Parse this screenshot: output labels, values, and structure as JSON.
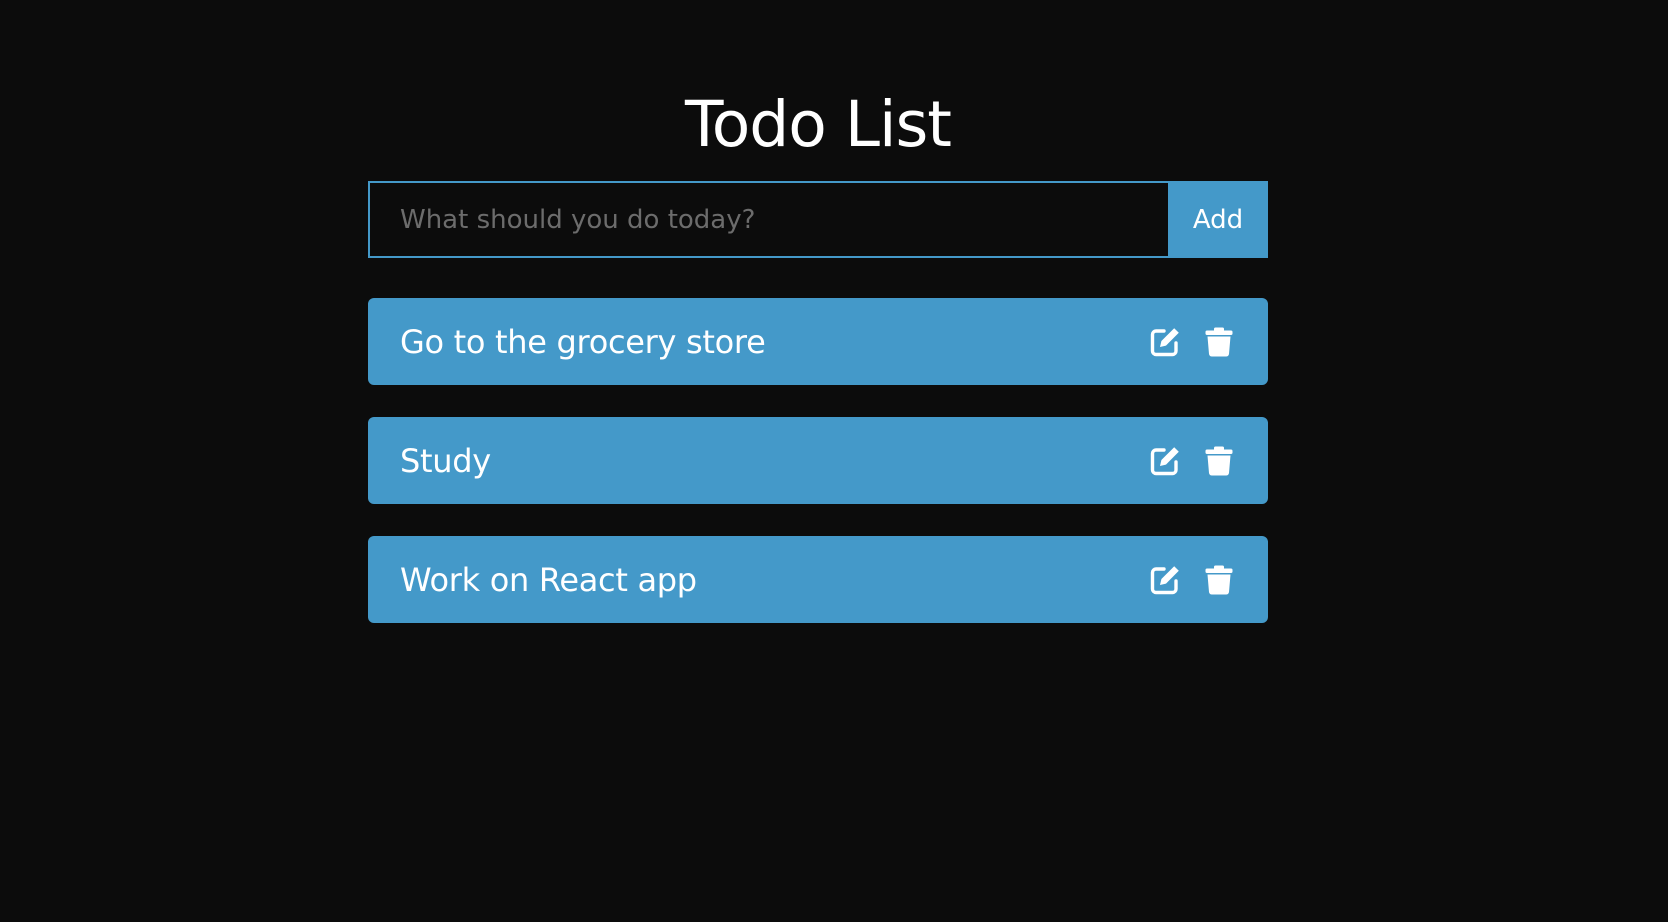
{
  "header": {
    "title": "Todo List"
  },
  "form": {
    "placeholder": "What should you do today?",
    "value": "",
    "add_label": "Add"
  },
  "todos": [
    {
      "text": "Go to the grocery store"
    },
    {
      "text": "Study"
    },
    {
      "text": "Work on React app"
    }
  ],
  "icons": {
    "edit": "edit-icon",
    "delete": "trash-icon"
  },
  "colors": {
    "background": "#0c0c0c",
    "accent": "#4499c9",
    "placeholder": "#6c6c6c",
    "text": "#ffffff"
  }
}
